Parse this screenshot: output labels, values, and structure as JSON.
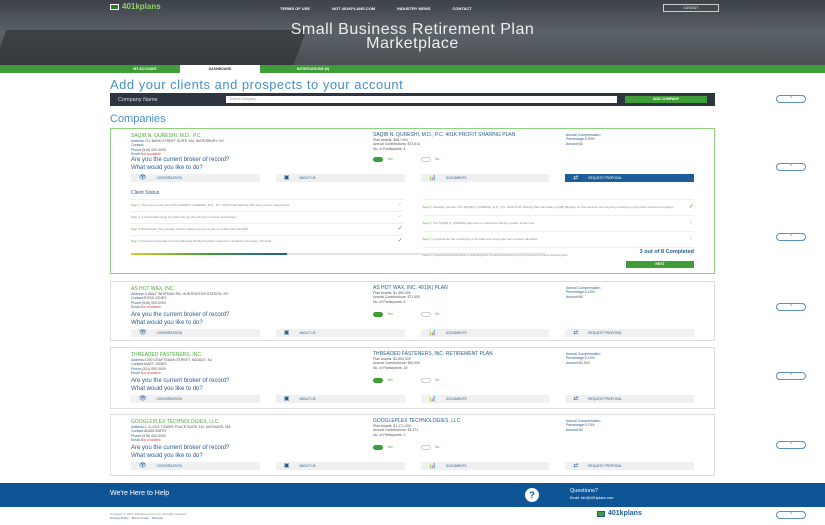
{
  "header": {
    "logo": "401kplans",
    "nav": [
      "TERMS OF USE",
      "NOT 401KPLANS.COM",
      "INDUSTRY NEWS",
      "CONTACT"
    ],
    "logout": "LOGOUT",
    "title_line1": "Small Business Retirement Plan",
    "title_line2": "Marketplace"
  },
  "tabs": [
    {
      "label": "MY ACCOUNT"
    },
    {
      "label": "DASHBOARD"
    },
    {
      "label": "NOTIFICATIONS (0)"
    }
  ],
  "heading": "Add your clients and prospects to your account",
  "search": {
    "label": "Company Name",
    "placeholder": "Select Company",
    "chevron": "⌄",
    "button": "ADD COMPANY"
  },
  "companies_heading": "Companies",
  "common": {
    "question1": "Are you the current broker of record?",
    "question2": "What would you like to do?",
    "yes": "Yes",
    "no": "No",
    "actions": [
      "CONVERSATION",
      "ABOUT US",
      "DOCUMENTS",
      "REQUEST PROPOSAL"
    ],
    "addr_label": "Address:",
    "contact_label": "Contact:",
    "phone_label": "Phone:",
    "email_label": "Email:",
    "email_na": "Not available",
    "comp_title": "Annual Compensation",
    "pct_label": "Percentage:",
    "amt_label": "Amount:"
  },
  "companies": [
    {
      "name": "SAQIB N. QURESHI, M.D., P.C.",
      "address": "712 BANK STREET SUITE 100, WATERBURY, NY",
      "contact": "",
      "phone": "(516) 000-0000",
      "plan": "SAQIB N. QURESHI, M.D., P.C. 401K PROFIT SHARING PLAN",
      "assets": "Plan Assets: $487,000",
      "contrib": "Annual Contributions: $73,614",
      "participants": "No. of Participants: 4",
      "pct": "0.50%",
      "amt": "$0"
    },
    {
      "name": "AS HOT WAX, INC.",
      "address": "3 WALT WHITMAN RD, HUNTINGTON STATION, NY",
      "contact": "ROSA JONES",
      "phone": "(516) 000-0000",
      "plan": "AS HOT WAX, INC. 401(K) PLAN",
      "assets": "Plan Assets: $1,350,000",
      "contrib": "Annual Contributions: $71,000",
      "participants": "No. of Participants: 2",
      "pct": "0.10%",
      "amt": "$0"
    },
    {
      "name": "THREADED FASTENERS, INC.",
      "address": "1000 CRAFTSMAN STREET, SADDLE, NJ",
      "contact": "MARY JONES",
      "phone": "(201) 000-0000",
      "plan": "THREADED FASTENERS, INC. RETIREMENT PLAN",
      "assets": "Plan Assets: $1,500,000",
      "contrib": "Annual Contributions: $90,000",
      "participants": "No. of Participants: 18",
      "pct": "0.10%",
      "amt": "$1,500"
    },
    {
      "name": "GOOGLEPLEX TECHNOLOGIES, LLC",
      "address": "1 CLOCK TOWER PLACE SUITE 310, MAYNARD, MA",
      "contact": "ADAM SMITH",
      "phone": "(978) 000-0000",
      "plan": "GOOGLEPLEX TECHNOLOGIES, LLC",
      "assets": "Plan Assets: $1,171,000",
      "contrib": "Annual Contributions: $3,371",
      "participants": "No. of Participants: 1",
      "pct": "0.10%",
      "amt": "$0"
    }
  ],
  "client_status": {
    "title": "Client Status",
    "steps_left": [
      {
        "k": "Step 1:",
        "t": "The current total cost of the SAQIB N. QURESHI, M.D., P.C. 401K Profit Sharing Plan has not been determined.",
        "done": false
      },
      {
        "k": "Step 2:",
        "t": "A reasonable range for total costs for the plan has not been determined.",
        "done": false
      },
      {
        "k": "Step 3:",
        "t": "Benchmark: The average current market price for a plan of similar size is $3,000.",
        "done": true
      },
      {
        "k": "Step 4:",
        "t": "Received proposals from the following 401(k) Providers: Ascensus, Guideline, Empower, Principal.",
        "done": true
      }
    ],
    "steps_right": [
      {
        "k": "Step 5:",
        "t": "Fiduciary Service: The SAQIB N. QURESHI, M.D., P.C. 401K Profit Sharing Plan will obtain a 3(38) fiduciary for the selection and ongoing monitoring of the plan's investment options.",
        "done": true
      },
      {
        "k": "Step 6:",
        "t": "The SAQIB N. QURESHI plan has not selected a 401(k) provider at this time.",
        "done": false
      },
      {
        "k": "Step 7:",
        "t": "A process for the monitoring of the total cost of the plan has not been identified.",
        "done": false
      },
      {
        "k": "Step 8:",
        "t": "Complete documentation of due diligence process and send a copy to the client for their fiduciary files.",
        "done": false
      }
    ],
    "progress": 0.375,
    "count": "3 out of 8 Completed",
    "next": "NEXT"
  },
  "footer": {
    "help": "We're Here to Help",
    "icon": "?",
    "questions": "Questions?",
    "email": "Email: info@401kplans.com",
    "copyright": "Copyright © 2017 401kplans.com LLC. All rights reserved.",
    "links": [
      "Privacy Policy",
      "Terms of Use",
      "Sitemap"
    ],
    "logo": "401kplans",
    "up": "⌃"
  }
}
